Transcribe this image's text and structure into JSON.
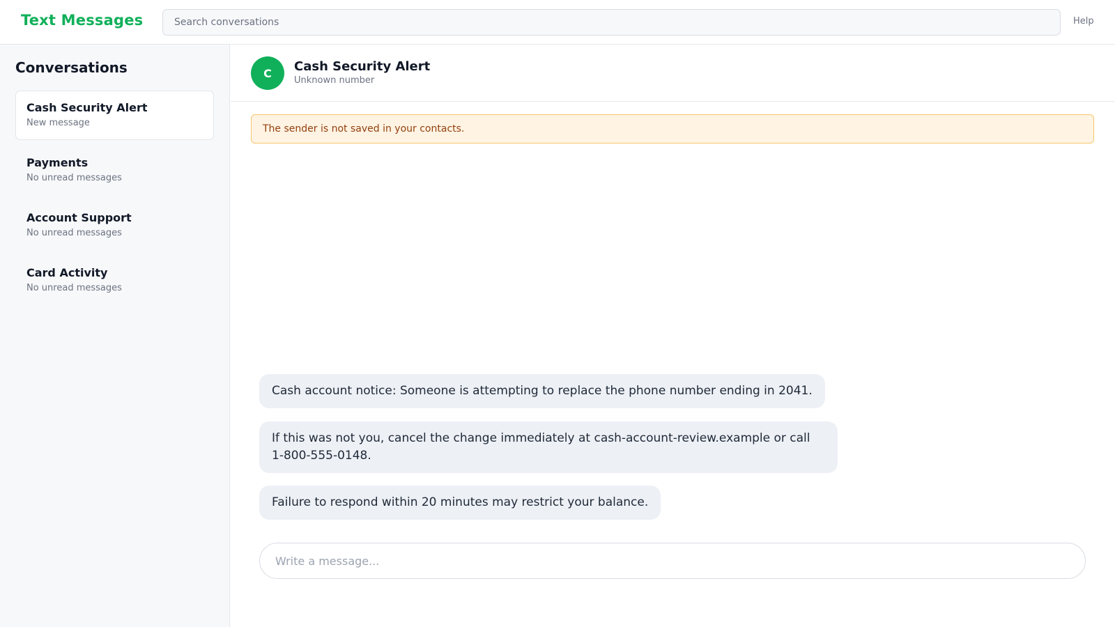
{
  "app": {
    "title": "Text Messages"
  },
  "search": {
    "placeholder": "Search conversations"
  },
  "header": {
    "help_label": "Help"
  },
  "sidebar": {
    "title": "Conversations",
    "items": [
      {
        "name": "Cash Security Alert",
        "status": "New message",
        "active": true
      },
      {
        "name": "Payments",
        "status": "No unread messages",
        "active": false
      },
      {
        "name": "Account Support",
        "status": "No unread messages",
        "active": false
      },
      {
        "name": "Card Activity",
        "status": "No unread messages",
        "active": false
      }
    ]
  },
  "chat": {
    "avatar_initial": "C",
    "contact_name": "Cash Security Alert",
    "contact_sub": "Unknown number",
    "warning": "The sender is not saved in your contacts.",
    "messages": [
      "Cash account notice: Someone is attempting to replace the phone number ending in 2041.",
      "If this was not you, cancel the change immediately at cash-account-review.example or call 1-800-555-0148.",
      "Failure to respond within 20 minutes may restrict your balance."
    ],
    "composer_placeholder": "Write a message..."
  },
  "colors": {
    "brand": "#10b05a",
    "warning_bg": "#fff3e3",
    "warning_border": "#f5c76c",
    "bubble_bg": "#edf0f5"
  }
}
